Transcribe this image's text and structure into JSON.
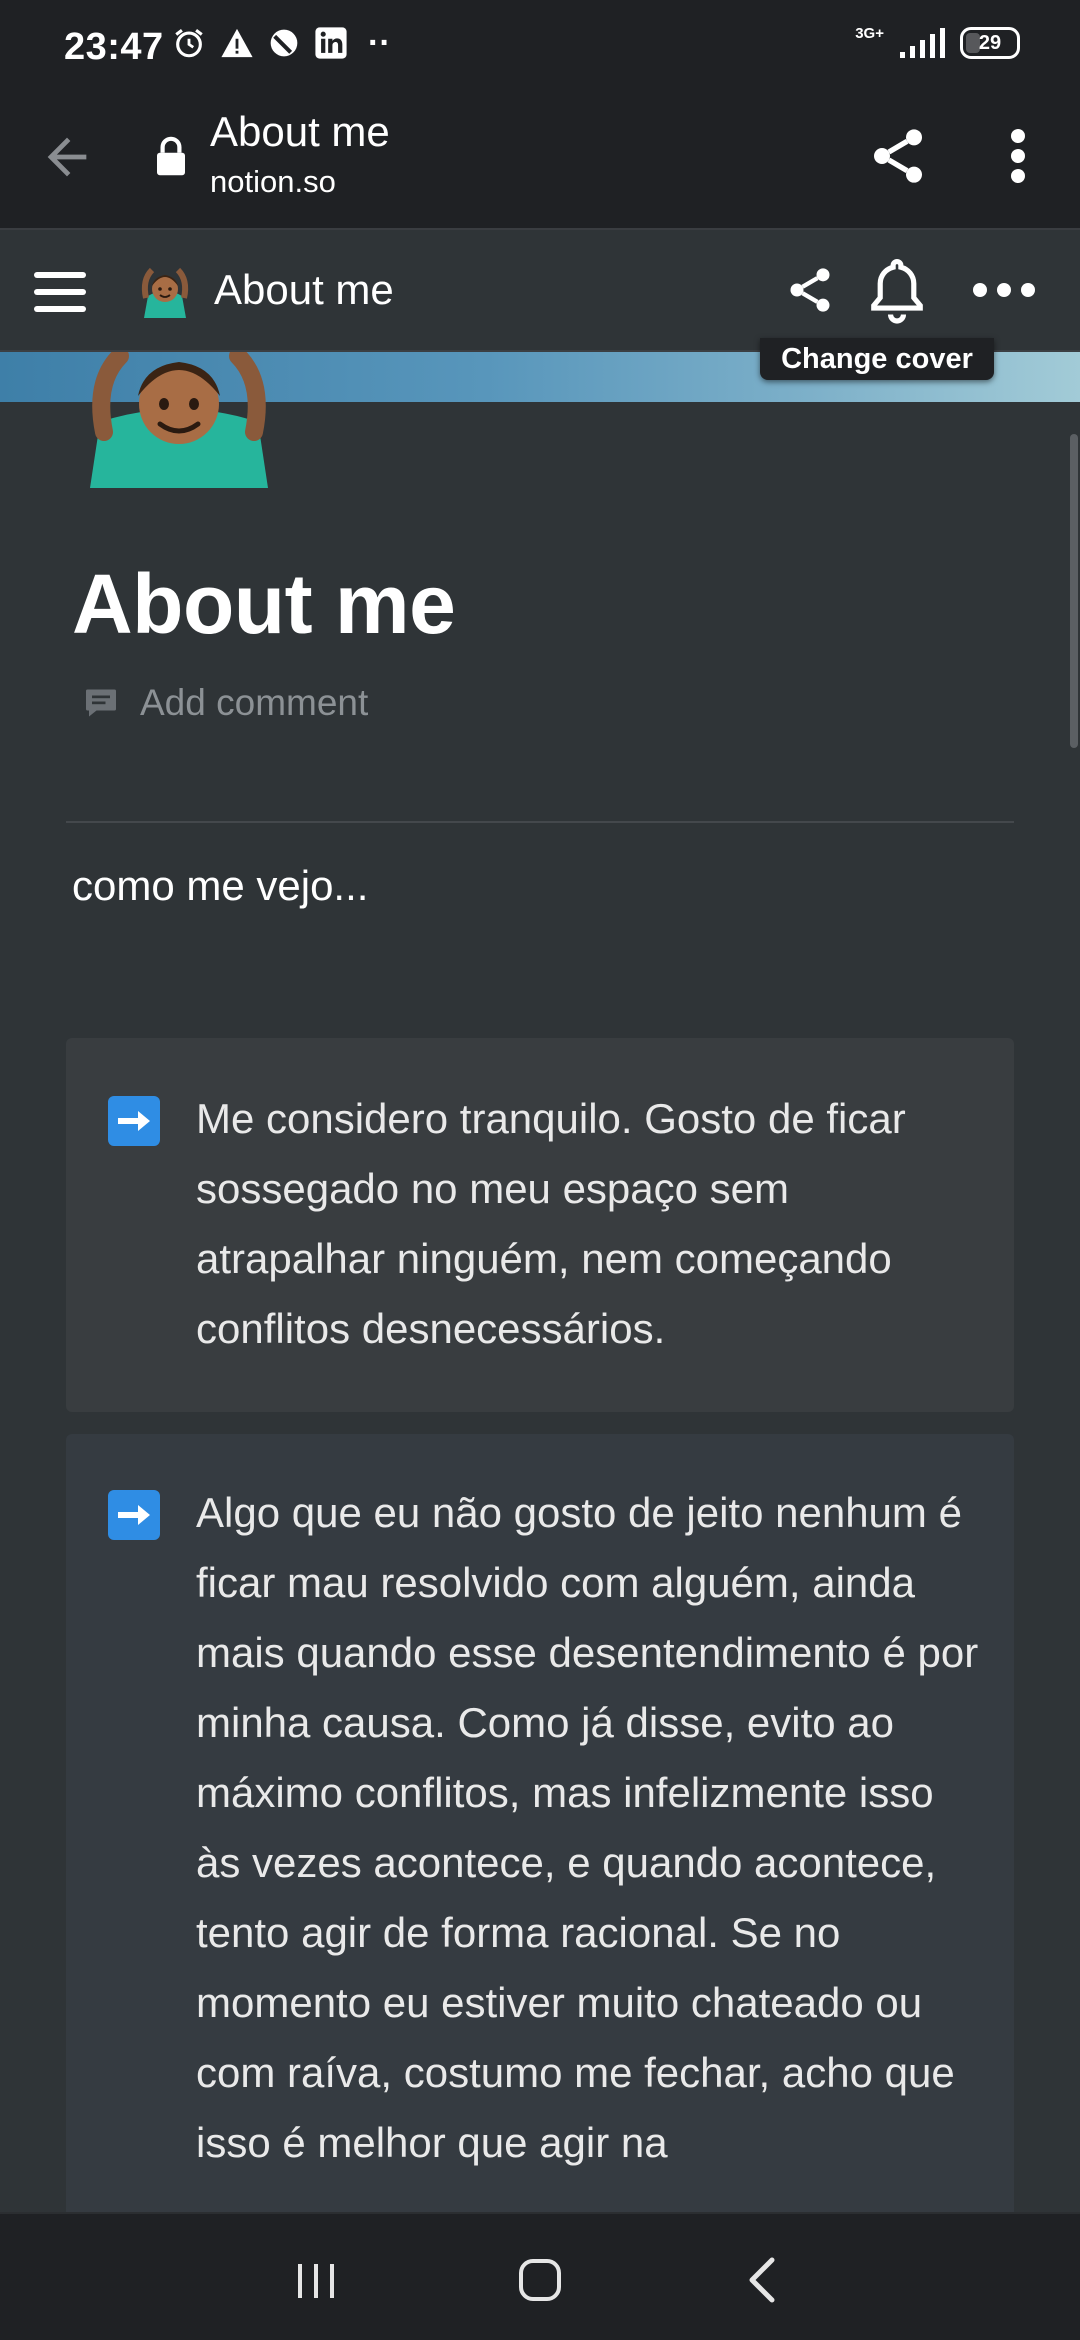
{
  "status_bar": {
    "time": "23:47",
    "network_label": "3G+",
    "battery": "29",
    "dots": "··",
    "icons": [
      "alarm-icon",
      "warning-icon",
      "do-not-disturb-icon",
      "linkedin-icon",
      "signal-icon",
      "battery-icon"
    ]
  },
  "browser": {
    "tab_title": "About me",
    "domain": "notion.so",
    "icons": [
      "back-arrow-icon",
      "lock-icon",
      "share-icon",
      "more-vert-icon"
    ]
  },
  "notion": {
    "breadcrumb_title": "About me",
    "page_emoji": "person-gesturing-ok-icon",
    "icons": [
      "menu-icon",
      "share-icon",
      "bell-icon",
      "more-horiz-icon"
    ],
    "change_cover_label": "Change cover",
    "cover_colors": [
      "#3e7fa8",
      "#a2cbd7"
    ]
  },
  "page": {
    "title": "About me",
    "add_comment_label": "Add comment",
    "intro": "como me vejo...",
    "callouts": [
      {
        "icon": "right-arrow-emoji-icon",
        "text": "Me considero tranquilo. Gosto de ficar sossegado no meu espaço sem atrapalhar ninguém, nem começando conflitos desnecessários."
      },
      {
        "icon": "right-arrow-emoji-icon",
        "text": "Algo que eu não gosto de jeito nenhum é ficar mau resolvido com alguém, ainda mais quando esse desentendimento é por minha causa. Como já disse, evito ao máximo conflitos, mas infelizmente isso às vezes acontece, e quando acontece, tento agir de forma racional. Se no momento eu estiver muito chateado ou com raíva, costumo me fechar, acho que isso é melhor que agir na"
      }
    ]
  },
  "nav_bar": {
    "icons": [
      "recent-apps-icon",
      "home-icon",
      "back-icon"
    ]
  },
  "colors": {
    "background": "#2f3437",
    "bars": "#1f2124",
    "callout": "#393d40",
    "accent_arrow": "#2f8de4"
  }
}
